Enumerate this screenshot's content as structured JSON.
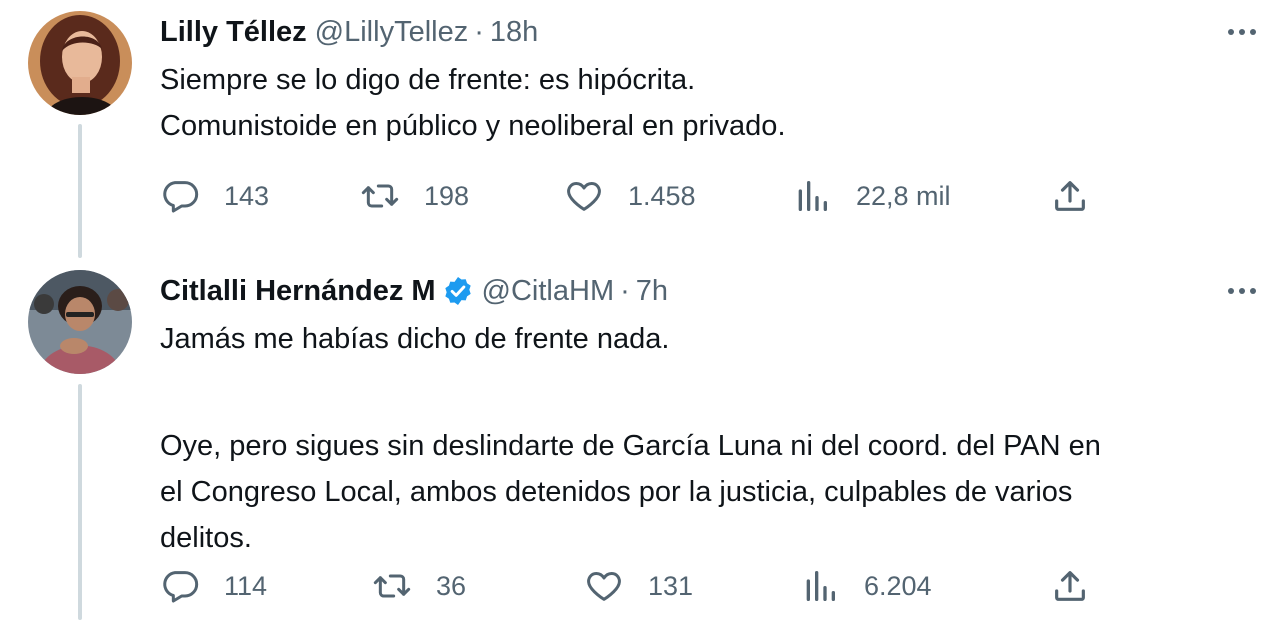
{
  "tweets": [
    {
      "display_name": "Lilly Téllez",
      "handle": "@LillyTellez",
      "separator": "·",
      "time": "18h",
      "verified": false,
      "text_lines": [
        "Siempre se lo digo de frente: es hipócrita.",
        "Comunistoide en público y neoliberal en privado."
      ],
      "replies": "143",
      "retweets": "198",
      "likes": "1.458",
      "views": "22,8 mil"
    },
    {
      "display_name": "Citlalli Hernández M",
      "handle": "@CitlaHM",
      "separator": "·",
      "time": "7h",
      "verified": true,
      "paragraph_1": "Jamás me habías dicho de frente nada.",
      "paragraph_2_lines": [
        "Oye, pero sigues sin deslindarte de García Luna ni del coord. del PAN en",
        "el Congreso Local, ambos detenidos por la justicia, culpables de varios",
        "delitos."
      ],
      "replies": "114",
      "retweets": "36",
      "likes": "131",
      "views": "6.204"
    }
  ],
  "colors": {
    "text_primary": "#0f1419",
    "text_secondary": "#536471",
    "verified_blue": "#1d9bf0",
    "thread_line": "#cfd9de"
  },
  "icons": [
    "reply-icon",
    "retweet-icon",
    "like-icon",
    "views-icon",
    "share-icon",
    "more-icon",
    "verified-badge-icon"
  ]
}
